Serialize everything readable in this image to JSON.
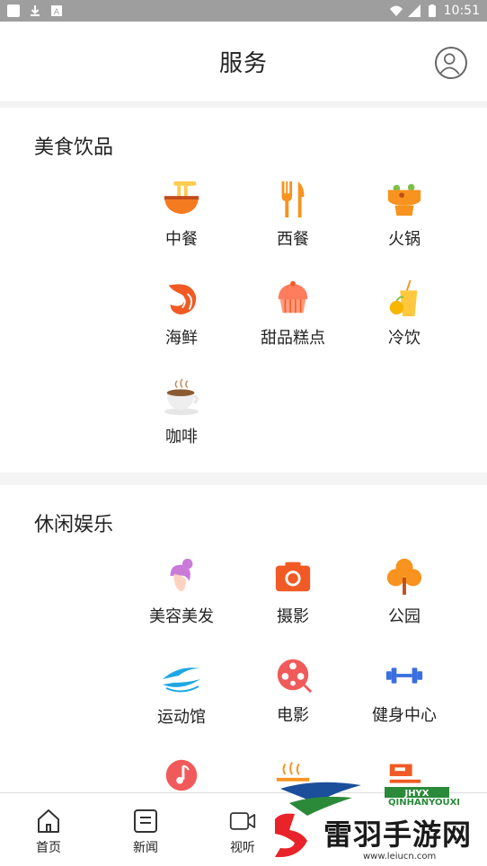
{
  "status_bar": {
    "time": "10:51"
  },
  "header": {
    "title": "服务"
  },
  "sections": [
    {
      "title": "美食饮品",
      "items": [
        {
          "label": "中餐",
          "icon": "noodle-bowl-icon"
        },
        {
          "label": "西餐",
          "icon": "fork-knife-icon"
        },
        {
          "label": "火锅",
          "icon": "hotpot-icon"
        },
        {
          "label": "海鲜",
          "icon": "shrimp-icon"
        },
        {
          "label": "甜品糕点",
          "icon": "cake-icon"
        },
        {
          "label": "冷饮",
          "icon": "cold-drink-icon"
        },
        {
          "label": "咖啡",
          "icon": "coffee-icon"
        }
      ]
    },
    {
      "title": "休闲娱乐",
      "items": [
        {
          "label": "美容美发",
          "icon": "hairdo-icon"
        },
        {
          "label": "摄影",
          "icon": "camera-icon"
        },
        {
          "label": "公园",
          "icon": "tree-icon"
        },
        {
          "label": "运动馆",
          "icon": "stadium-icon"
        },
        {
          "label": "电影",
          "icon": "film-reel-icon"
        },
        {
          "label": "健身中心",
          "icon": "dumbbell-icon"
        }
      ]
    }
  ],
  "tabs": [
    {
      "label": "首页",
      "icon": "home-icon"
    },
    {
      "label": "新闻",
      "icon": "news-icon"
    },
    {
      "label": "视听",
      "icon": "video-icon"
    }
  ],
  "watermark": {
    "brand": "雷羽手游网",
    "tag": "QINHANYOUXI",
    "url": "www.leiucn.com"
  },
  "colors": {
    "accent": "#f7931e",
    "text": "#222222",
    "statusbar": "#9e9e9e"
  }
}
